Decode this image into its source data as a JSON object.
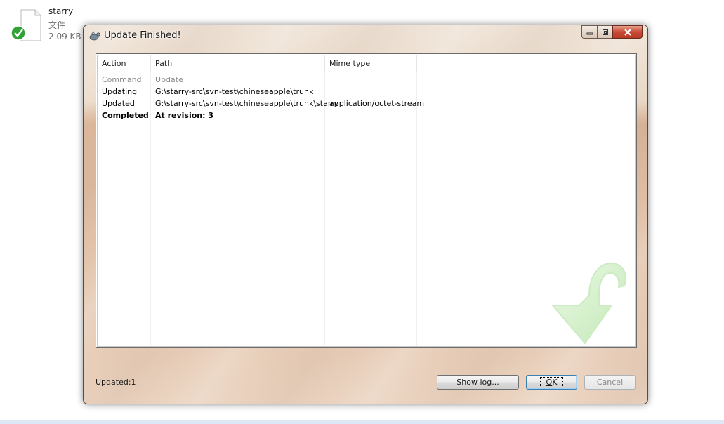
{
  "desktop": {
    "file_name": "starry",
    "file_type": "文件",
    "file_size": "2.09 KB"
  },
  "dialog": {
    "title": "Update Finished!",
    "columns": [
      "Action",
      "Path",
      "Mime type"
    ],
    "rows": [
      {
        "action": "Command",
        "path": "Update",
        "mime": ""
      },
      {
        "action": "Updating",
        "path": "G:\\starry-src\\svn-test\\chineseapple\\trunk",
        "mime": ""
      },
      {
        "action": "Updated",
        "path": "G:\\starry-src\\svn-test\\chineseapple\\trunk\\starry",
        "mime": "application/octet-stream"
      },
      {
        "action": "Completed",
        "path": "At revision: 3",
        "mime": ""
      }
    ],
    "status": "Updated:1",
    "buttons": {
      "show_log": "Show log...",
      "ok_prefix": "O",
      "ok_rest": "K",
      "cancel": "Cancel"
    }
  },
  "colors": {
    "accent_green": "#9ad38a",
    "close_red": "#c94a35"
  },
  "icons": {
    "file": "document-icon",
    "status_badge": "checkmark-icon",
    "window": "tortoisesvn-icon",
    "watermark": "update-arrow-icon"
  }
}
